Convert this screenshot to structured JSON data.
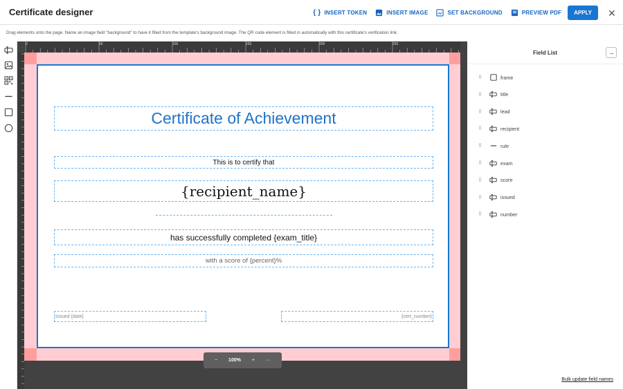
{
  "header": {
    "title": "Certificate designer",
    "actions": {
      "insert_token": "INSERT TOKEN",
      "insert_image": "INSERT IMAGE",
      "set_background": "SET BACKGROUND",
      "preview_pdf": "PREVIEW PDF",
      "apply": "APPLY"
    },
    "close_glyph": "✕"
  },
  "hint": "Drag elements onto the page. Name an image field \"background\" to have it filled from the template's background image. The QR code element is filled in automatically with this certificate's verification link.",
  "toolbar": {
    "icons": [
      "text-field-icon",
      "image-icon",
      "qr-code-icon",
      "line-icon",
      "rectangle-icon",
      "ellipse-icon"
    ]
  },
  "ruler": {
    "labels": [
      "0",
      "50",
      "100",
      "150",
      "200",
      "250"
    ]
  },
  "certificate": {
    "title": "Certificate of Achievement",
    "lead": "This is to certify that",
    "recipient": "{recipient_name}",
    "exam": "has successfully completed {exam_title}",
    "score": "with a score of {percent}%",
    "issued": "Issued {date}",
    "number": "{cert_number}"
  },
  "zoom": {
    "minus": "−",
    "value": "100%",
    "plus": "+",
    "more": "···"
  },
  "panel": {
    "title": "Field List",
    "collapse_glyph": "→",
    "fields": [
      {
        "name": "frame",
        "icon": "rectangle-icon"
      },
      {
        "name": "title",
        "icon": "text-field-icon"
      },
      {
        "name": "lead",
        "icon": "text-field-icon"
      },
      {
        "name": "recipient",
        "icon": "text-field-icon"
      },
      {
        "name": "rule",
        "icon": "line-icon"
      },
      {
        "name": "exam",
        "icon": "text-field-icon"
      },
      {
        "name": "score",
        "icon": "text-field-icon"
      },
      {
        "name": "issued",
        "icon": "text-field-icon"
      },
      {
        "name": "number",
        "icon": "text-field-icon"
      }
    ],
    "bulk_update": "Bulk update field names"
  },
  "colors": {
    "accent": "#1976d2",
    "title_text": "#1e73c8",
    "bleed": "#ffcdd2",
    "workspace": "#424242"
  }
}
